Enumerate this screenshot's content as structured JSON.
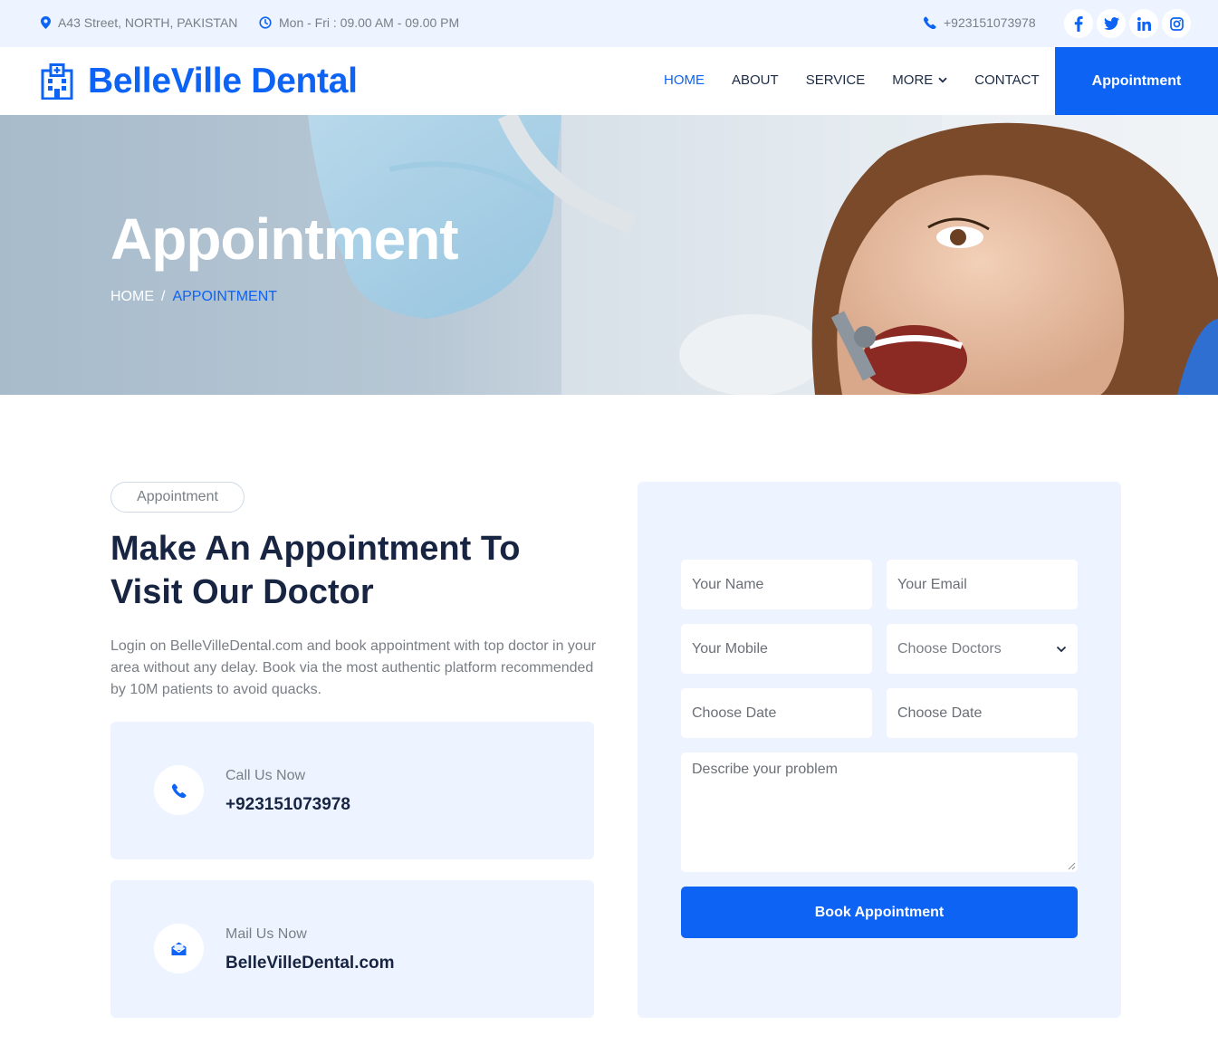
{
  "topbar": {
    "address": "A43 Street, NORTH, PAKISTAN",
    "hours": "Mon - Fri : 09.00 AM - 09.00 PM",
    "phone": "+923151073978",
    "socials": [
      "facebook-icon",
      "twitter-icon",
      "linkedin-icon",
      "instagram-icon"
    ]
  },
  "navbar": {
    "brand": "BelleVille Dental",
    "links": {
      "home": "HOME",
      "about": "ABOUT",
      "service": "SERVICE",
      "more": "MORE",
      "contact": "CONTACT"
    },
    "cta": "Appointment"
  },
  "hero": {
    "title": "Appointment",
    "breadcrumb_home": "HOME",
    "breadcrumb_separator": "/",
    "breadcrumb_current": "APPOINTMENT"
  },
  "intro": {
    "tag": "Appointment",
    "heading": "Make An Appointment To Visit Our Doctor",
    "paragraph": "Login on BelleVilleDental.com and book appointment with top doctor in your area without any delay. Book via the most authentic platform recommended by 10M patients to avoid quacks."
  },
  "contact_cards": {
    "call_label": "Call Us Now",
    "call_value": "+923151073978",
    "mail_label": "Mail Us Now",
    "mail_value": "BelleVilleDental.com"
  },
  "form": {
    "name_placeholder": "Your Name",
    "email_placeholder": "Your Email",
    "mobile_placeholder": "Your Mobile",
    "doctor_select": "Choose Doctors",
    "date1_placeholder": "Choose Date",
    "date2_placeholder": "Choose Date",
    "problem_placeholder": "Describe your problem",
    "submit_label": "Book Appointment"
  },
  "colors": {
    "accent": "#0d63f3",
    "heading": "#182542",
    "light_bg": "#eef4ff"
  }
}
